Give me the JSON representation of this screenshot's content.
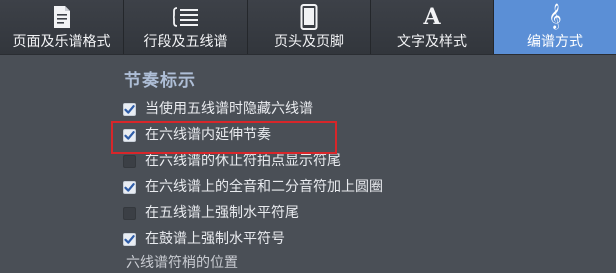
{
  "tabs": [
    {
      "label": "页面及乐谱格式",
      "icon": "page-icon",
      "active": false
    },
    {
      "label": "行段及五线谱",
      "icon": "staff-lines-icon",
      "active": false
    },
    {
      "label": "页头及页脚",
      "icon": "phone-page-icon",
      "active": false
    },
    {
      "label": "文字及样式",
      "icon": "letter-a-icon",
      "glyph": "A",
      "active": false
    },
    {
      "label": "编谱方式",
      "icon": "treble-clef-icon",
      "glyph": "𝄞",
      "active": true
    }
  ],
  "section": {
    "title": "节奏标示"
  },
  "options": [
    {
      "label": "当使用五线谱时隐藏六线谱",
      "checked": true
    },
    {
      "label": "在六线谱内延伸节奏",
      "checked": true
    },
    {
      "label": "在六线谱的休止符拍点显示符尾",
      "checked": false
    },
    {
      "label": "在六线谱上的全音和二分音符加上圆圈",
      "checked": true
    },
    {
      "label": "在五线谱上强制水平符尾",
      "checked": false
    },
    {
      "label": "在鼓谱上强制水平符号",
      "checked": true
    }
  ],
  "partial_next_label": "六线谱符梢的位置",
  "colors": {
    "active_tab": "#5b8fd6",
    "highlight_box": "#d8262a",
    "section_title": "#aebed6"
  }
}
